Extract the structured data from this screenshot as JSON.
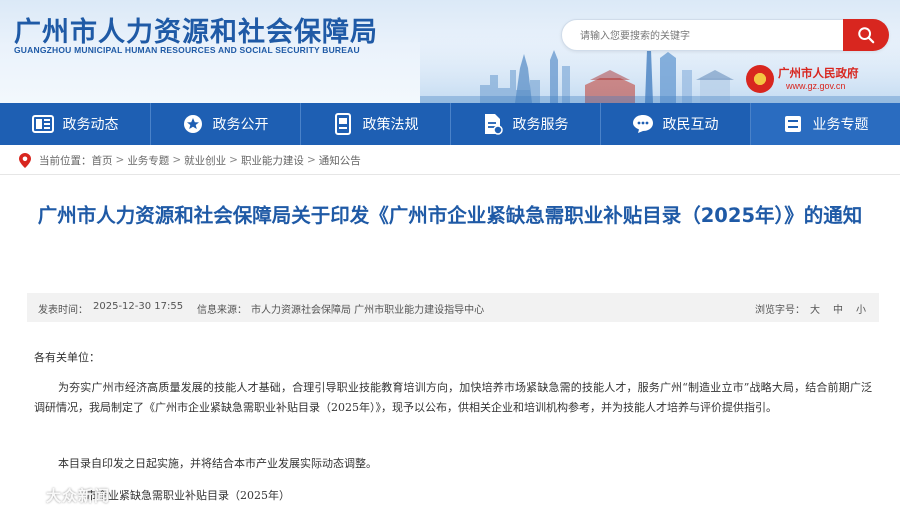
{
  "header": {
    "title_cn": "广州市人力资源和社会保障局",
    "title_en": "GUANGZHOU MUNICIPAL HUMAN RESOURCES AND SOCIAL SECURITY BUREAU",
    "search_placeholder": "请输入您要搜索的关键字",
    "gov_name": "广州市人民政府",
    "gov_url": "www.gz.gov.cn",
    "colors": {
      "brand_blue": "#1f5aa6",
      "nav_blue": "#1e5fb3",
      "accent_red": "#d8261f"
    }
  },
  "nav": [
    {
      "label": "政务动态",
      "icon": "news-icon"
    },
    {
      "label": "政务公开",
      "icon": "star-icon"
    },
    {
      "label": "政策法规",
      "icon": "book-icon"
    },
    {
      "label": "政务服务",
      "icon": "document-icon"
    },
    {
      "label": "政民互动",
      "icon": "chat-icon"
    },
    {
      "label": "业务专题",
      "icon": "list-icon"
    }
  ],
  "breadcrumb": {
    "prefix": "当前位置：",
    "items": [
      "首页",
      "业务专题",
      "就业创业",
      "职业能力建设",
      "通知公告"
    ],
    "separator": ">"
  },
  "article": {
    "title": "广州市人力资源和社会保障局关于印发《广州市企业紧缺急需职业补贴目录（2025年）》的通知",
    "meta": {
      "publish_label": "发表时间：",
      "publish_time": "2025-12-30 17:55",
      "source_label": "信息来源：",
      "source": "市人力资源社会保障局 广州市职业能力建设指导中心",
      "font_size_label": "浏览字号：",
      "sizes": [
        "大",
        "中",
        "小"
      ]
    },
    "salutation": "各有关单位：",
    "paragraph_1": "为夯实广州市经济高质量发展的技能人才基础，合理引导职业技能教育培训方向，加快培养市场紧缺急需的技能人才，服务广州“制造业立市”战略大局，结合前期广泛调研情况，我局制定了《广州市企业紧缺急需职业补贴目录（2025年）》，现予以公布，供相关企业和培训机构参考，并为技能人才培养与评价提供指引。",
    "paragraph_2": "本目录自印发之日起实施，并将结合本市产业发展实际动态调整。",
    "attachment": "市企业紧缺急需职业补贴目录（2025年）"
  },
  "watermark": "大众新闻"
}
